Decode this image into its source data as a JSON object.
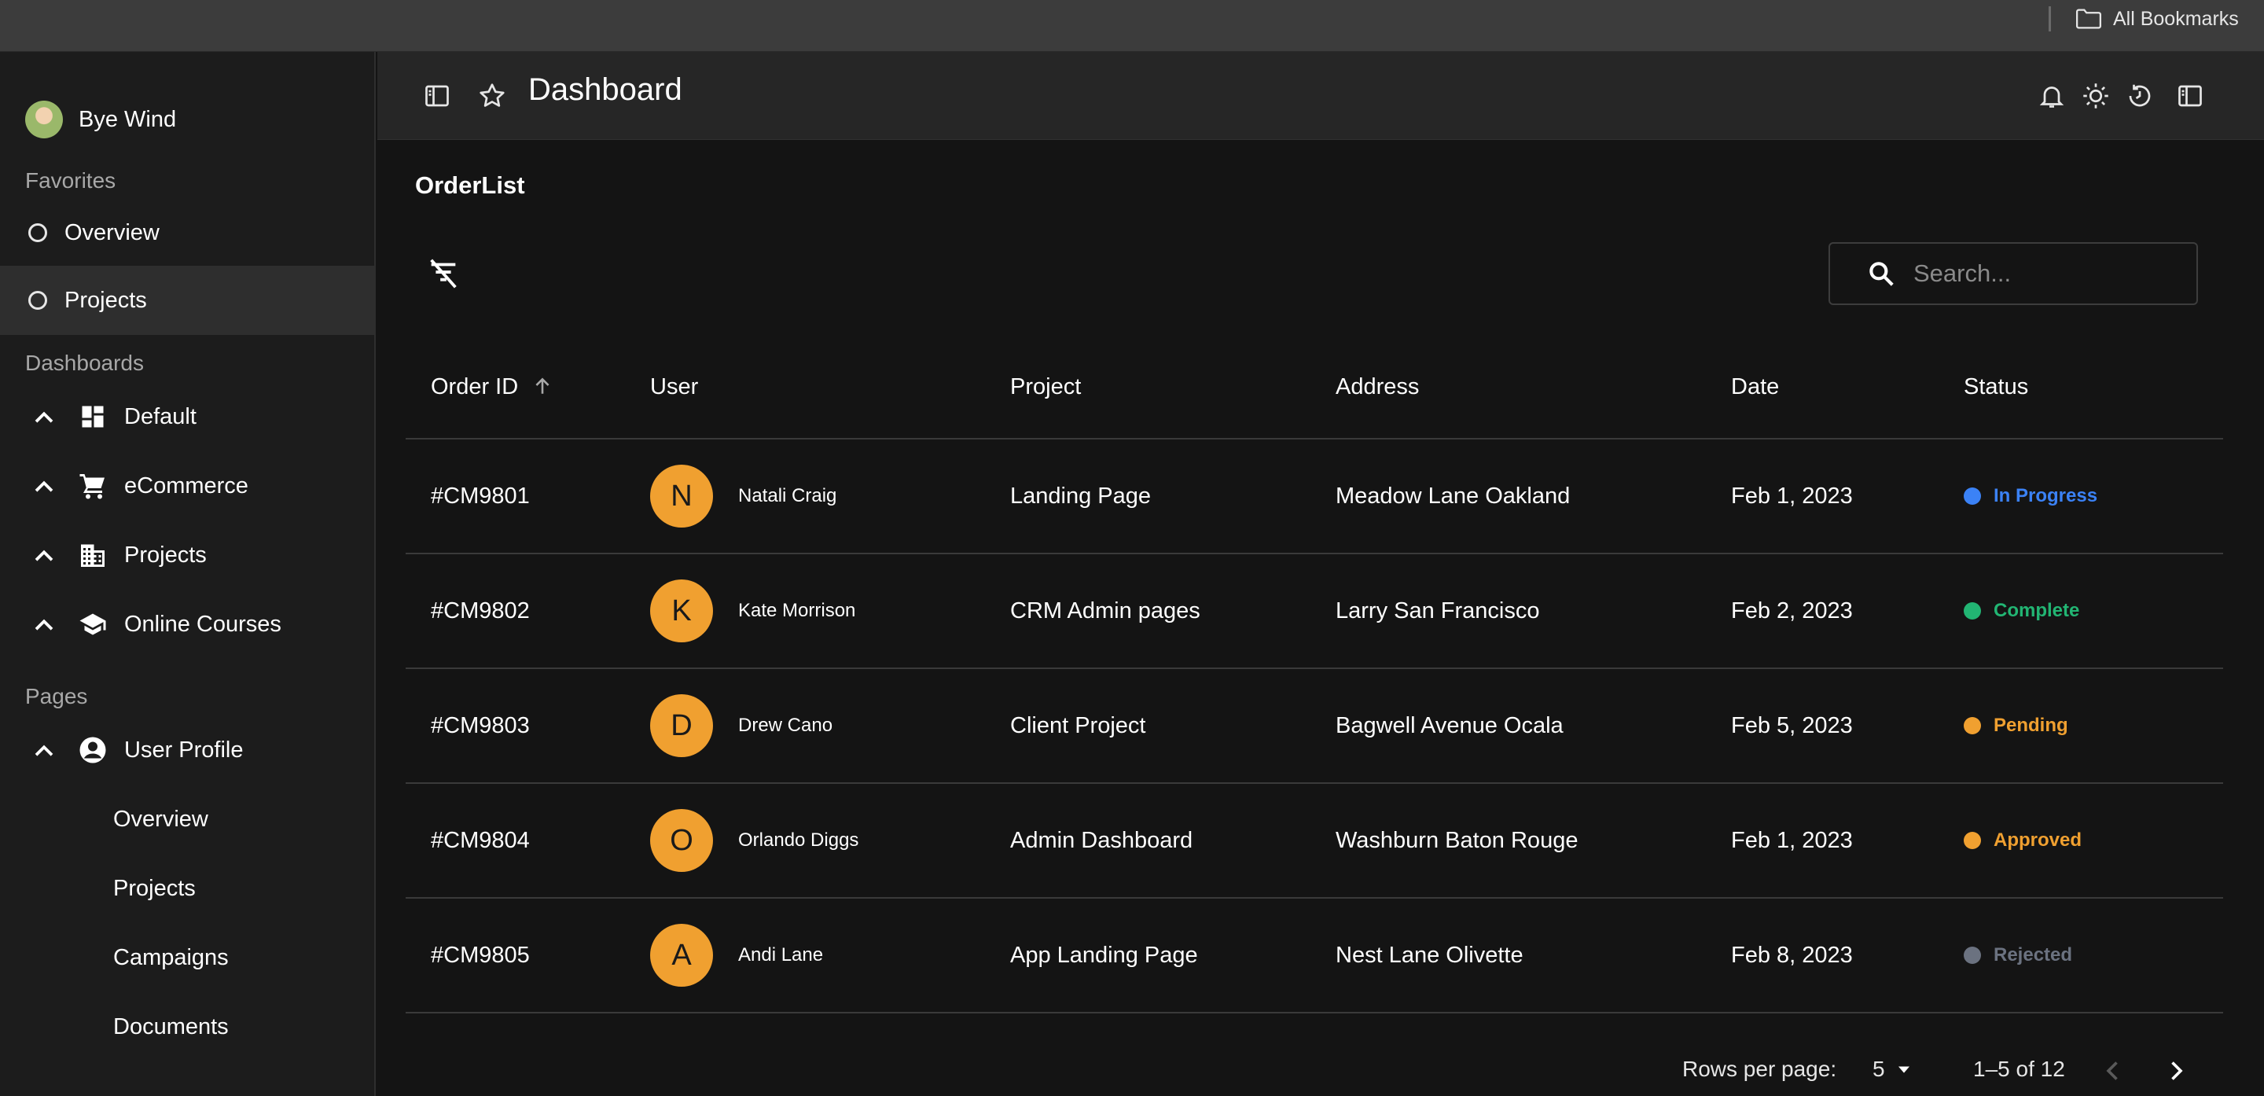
{
  "browser": {
    "bookmarks_folder_label": "All Bookmarks"
  },
  "sidebar": {
    "user_name": "Bye Wind",
    "favorites_title": "Favorites",
    "favorites": [
      {
        "label": "Overview"
      },
      {
        "label": "Projects",
        "active": true
      }
    ],
    "dashboards_title": "Dashboards",
    "dashboards": [
      {
        "label": "Default",
        "icon": "dashboard-icon"
      },
      {
        "label": "eCommerce",
        "icon": "cart-icon"
      },
      {
        "label": "Projects",
        "icon": "building-icon"
      },
      {
        "label": "Online Courses",
        "icon": "graduation-cap-icon"
      }
    ],
    "pages_title": "Pages",
    "pages": [
      {
        "label": "User Profile",
        "icon": "account-circle-icon"
      }
    ],
    "user_profile_children": [
      {
        "label": "Overview"
      },
      {
        "label": "Projects"
      },
      {
        "label": "Campaigns"
      },
      {
        "label": "Documents"
      }
    ]
  },
  "header": {
    "title": "Dashboard",
    "left_icons": [
      "sidebar-toggle-icon",
      "star-icon"
    ],
    "right_icons": [
      "bell-icon",
      "sun-icon",
      "history-icon",
      "sidebar-right-icon"
    ]
  },
  "main": {
    "title": "OrderList",
    "search_placeholder": "Search...",
    "table": {
      "columns": [
        "Order ID",
        "User",
        "Project",
        "Address",
        "Date",
        "Status"
      ],
      "sorted_column": "Order ID",
      "sort_direction": "ascending",
      "rows": [
        {
          "id": "#CM9801",
          "initial": "N",
          "user": "Natali Craig",
          "project": "Landing Page",
          "address": "Meadow Lane Oakland",
          "date": "Feb 1, 2023",
          "status": "In Progress",
          "status_color": "#3b82f6"
        },
        {
          "id": "#CM9802",
          "initial": "K",
          "user": "Kate Morrison",
          "project": "CRM Admin pages",
          "address": "Larry San Francisco",
          "date": "Feb 2, 2023",
          "status": "Complete",
          "status_color": "#22b573"
        },
        {
          "id": "#CM9803",
          "initial": "D",
          "user": "Drew Cano",
          "project": "Client Project",
          "address": "Bagwell Avenue Ocala",
          "date": "Feb 5, 2023",
          "status": "Pending",
          "status_color": "#f0a030"
        },
        {
          "id": "#CM9804",
          "initial": "O",
          "user": "Orlando Diggs",
          "project": "Admin Dashboard",
          "address": "Washburn Baton Rouge",
          "date": "Feb 1, 2023",
          "status": "Approved",
          "status_color": "#f0a030"
        },
        {
          "id": "#CM9805",
          "initial": "A",
          "user": "Andi Lane",
          "project": "App Landing Page",
          "address": "Nest Lane Olivette",
          "date": "Feb 8, 2023",
          "status": "Rejected",
          "status_color": "#6b7280"
        }
      ]
    },
    "pagination": {
      "rows_per_page_label": "Rows per page:",
      "rows_per_page": "5",
      "range": "1–5 of 12"
    }
  },
  "colors": {
    "avatar_bg": "#f0a030",
    "sidebar_bg": "#1c1c1c",
    "content_bg": "#141414",
    "header_bg": "#262626"
  }
}
